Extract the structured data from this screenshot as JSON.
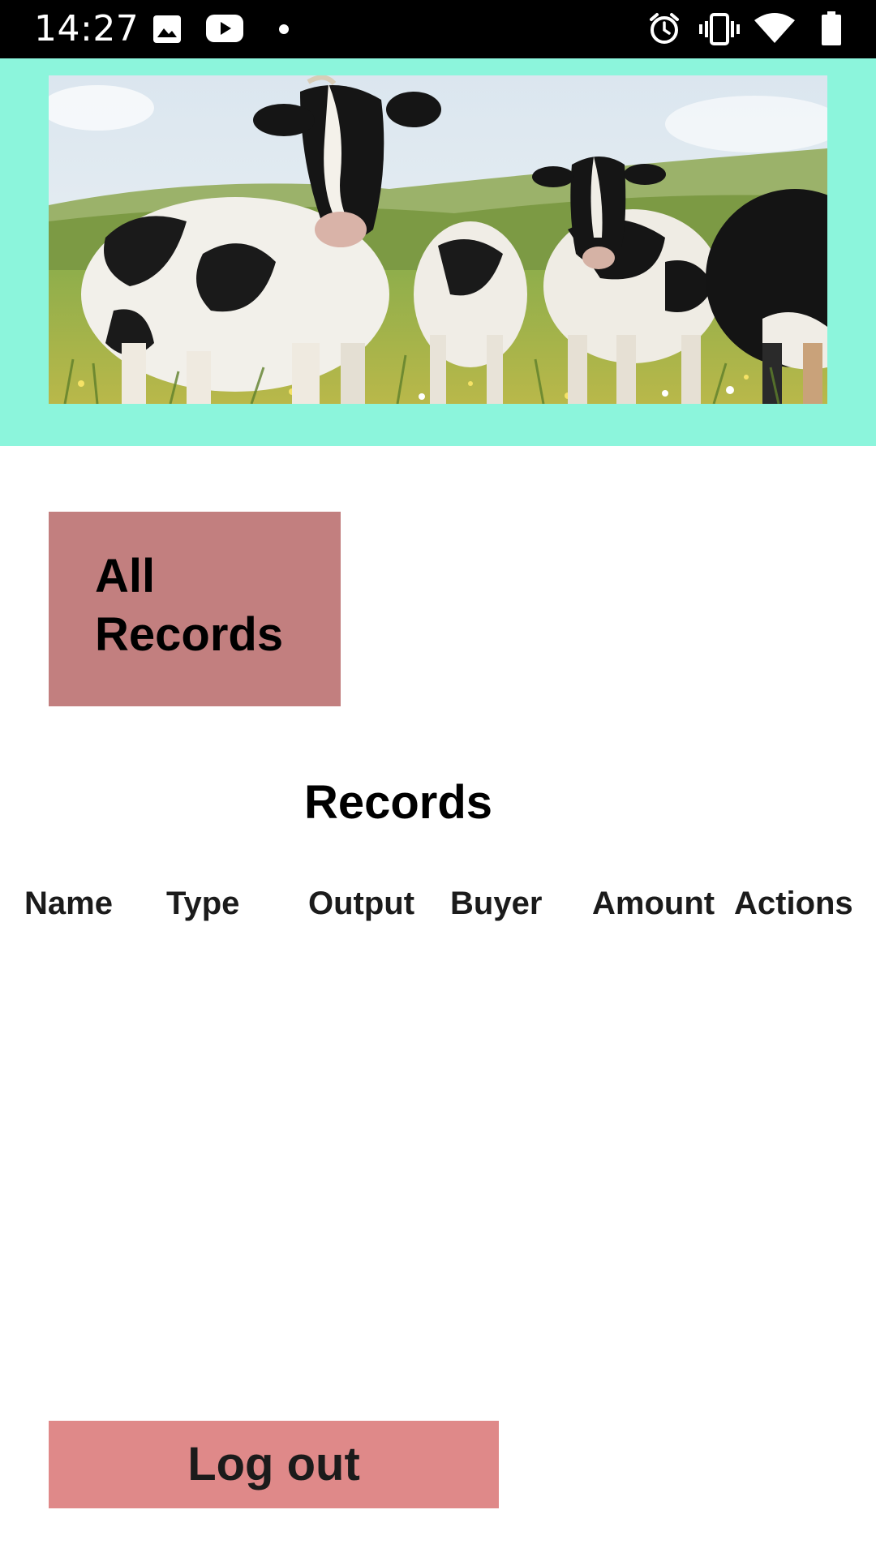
{
  "status_bar": {
    "time": "14:27",
    "left_icons": [
      "image-icon",
      "youtube-icon",
      "dot-icon"
    ],
    "right_icons": [
      "alarm-icon",
      "vibrate-icon",
      "wifi-icon",
      "battery-icon"
    ]
  },
  "header": {
    "background_color": "#8cf5dc",
    "banner_image": "cows-in-pasture-photo"
  },
  "all_records_button": {
    "label": "All Records",
    "color": "#c27f7f"
  },
  "records": {
    "title": "Records",
    "columns": [
      "Name",
      "Type",
      "Output",
      "Buyer",
      "Amount",
      "Actions"
    ],
    "rows": []
  },
  "logout_button": {
    "label": "Log out",
    "color": "#df8989"
  }
}
